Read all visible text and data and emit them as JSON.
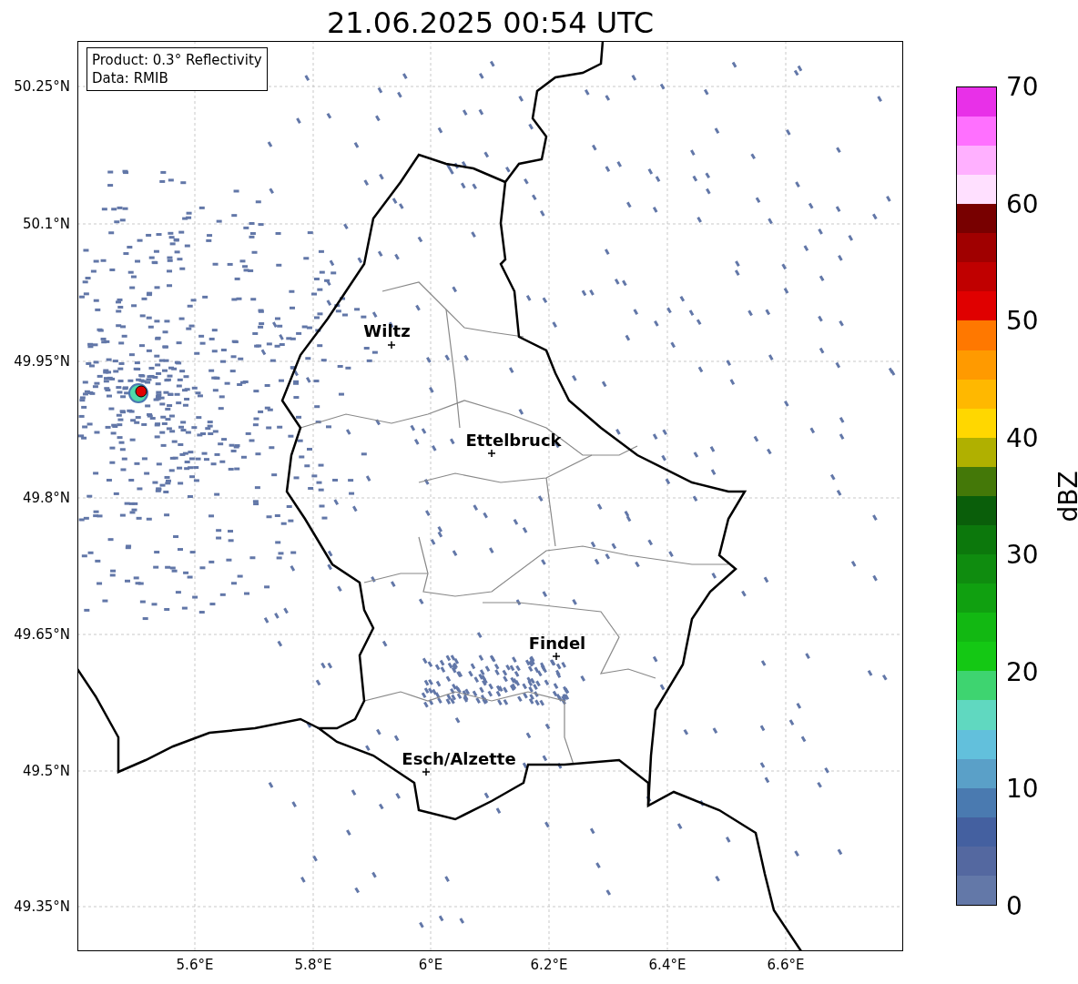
{
  "title": "21.06.2025 00:54 UTC",
  "info_box": {
    "lines": [
      "Product: 0.3° Reflectivity",
      "Data: RMIB"
    ]
  },
  "map": {
    "cities": [
      {
        "name": "Wiltz"
      },
      {
        "name": "Ettelbruck"
      },
      {
        "name": "Findel"
      },
      {
        "name": "Esch/Alzette"
      }
    ]
  },
  "y_ticks": [
    "50.25°N",
    "50.1°N",
    "49.95°N",
    "49.8°N",
    "49.65°N",
    "49.5°N",
    "49.35°N"
  ],
  "x_ticks": [
    "5.6°E",
    "5.8°E",
    "6°E",
    "6.2°E",
    "6.4°E",
    "6.6°E"
  ],
  "colorbar": {
    "label": "dBZ",
    "ticks": [
      "70",
      "60",
      "50",
      "40",
      "30",
      "20",
      "10",
      "0"
    ],
    "bins": [
      {
        "color": "#6378a8"
      },
      {
        "color": "#5468a0"
      },
      {
        "color": "#4460a0"
      },
      {
        "color": "#4a7ab0"
      },
      {
        "color": "#5aa0c8"
      },
      {
        "color": "#62c0dc"
      },
      {
        "color": "#60d8c0"
      },
      {
        "color": "#3ed470"
      },
      {
        "color": "#14c814"
      },
      {
        "color": "#12b812"
      },
      {
        "color": "#10a010"
      },
      {
        "color": "#0f8c0f"
      },
      {
        "color": "#0c780c"
      },
      {
        "color": "#0a5e0a"
      },
      {
        "color": "#447808"
      },
      {
        "color": "#b0b000"
      },
      {
        "color": "#ffd700"
      },
      {
        "color": "#ffb800"
      },
      {
        "color": "#ff9a00"
      },
      {
        "color": "#ff7800"
      },
      {
        "color": "#e00000"
      },
      {
        "color": "#c00000"
      },
      {
        "color": "#a00000"
      },
      {
        "color": "#780000"
      },
      {
        "color": "#ffe0ff"
      },
      {
        "color": "#ffb0ff"
      },
      {
        "color": "#ff70ff"
      },
      {
        "color": "#e830e8"
      }
    ]
  }
}
